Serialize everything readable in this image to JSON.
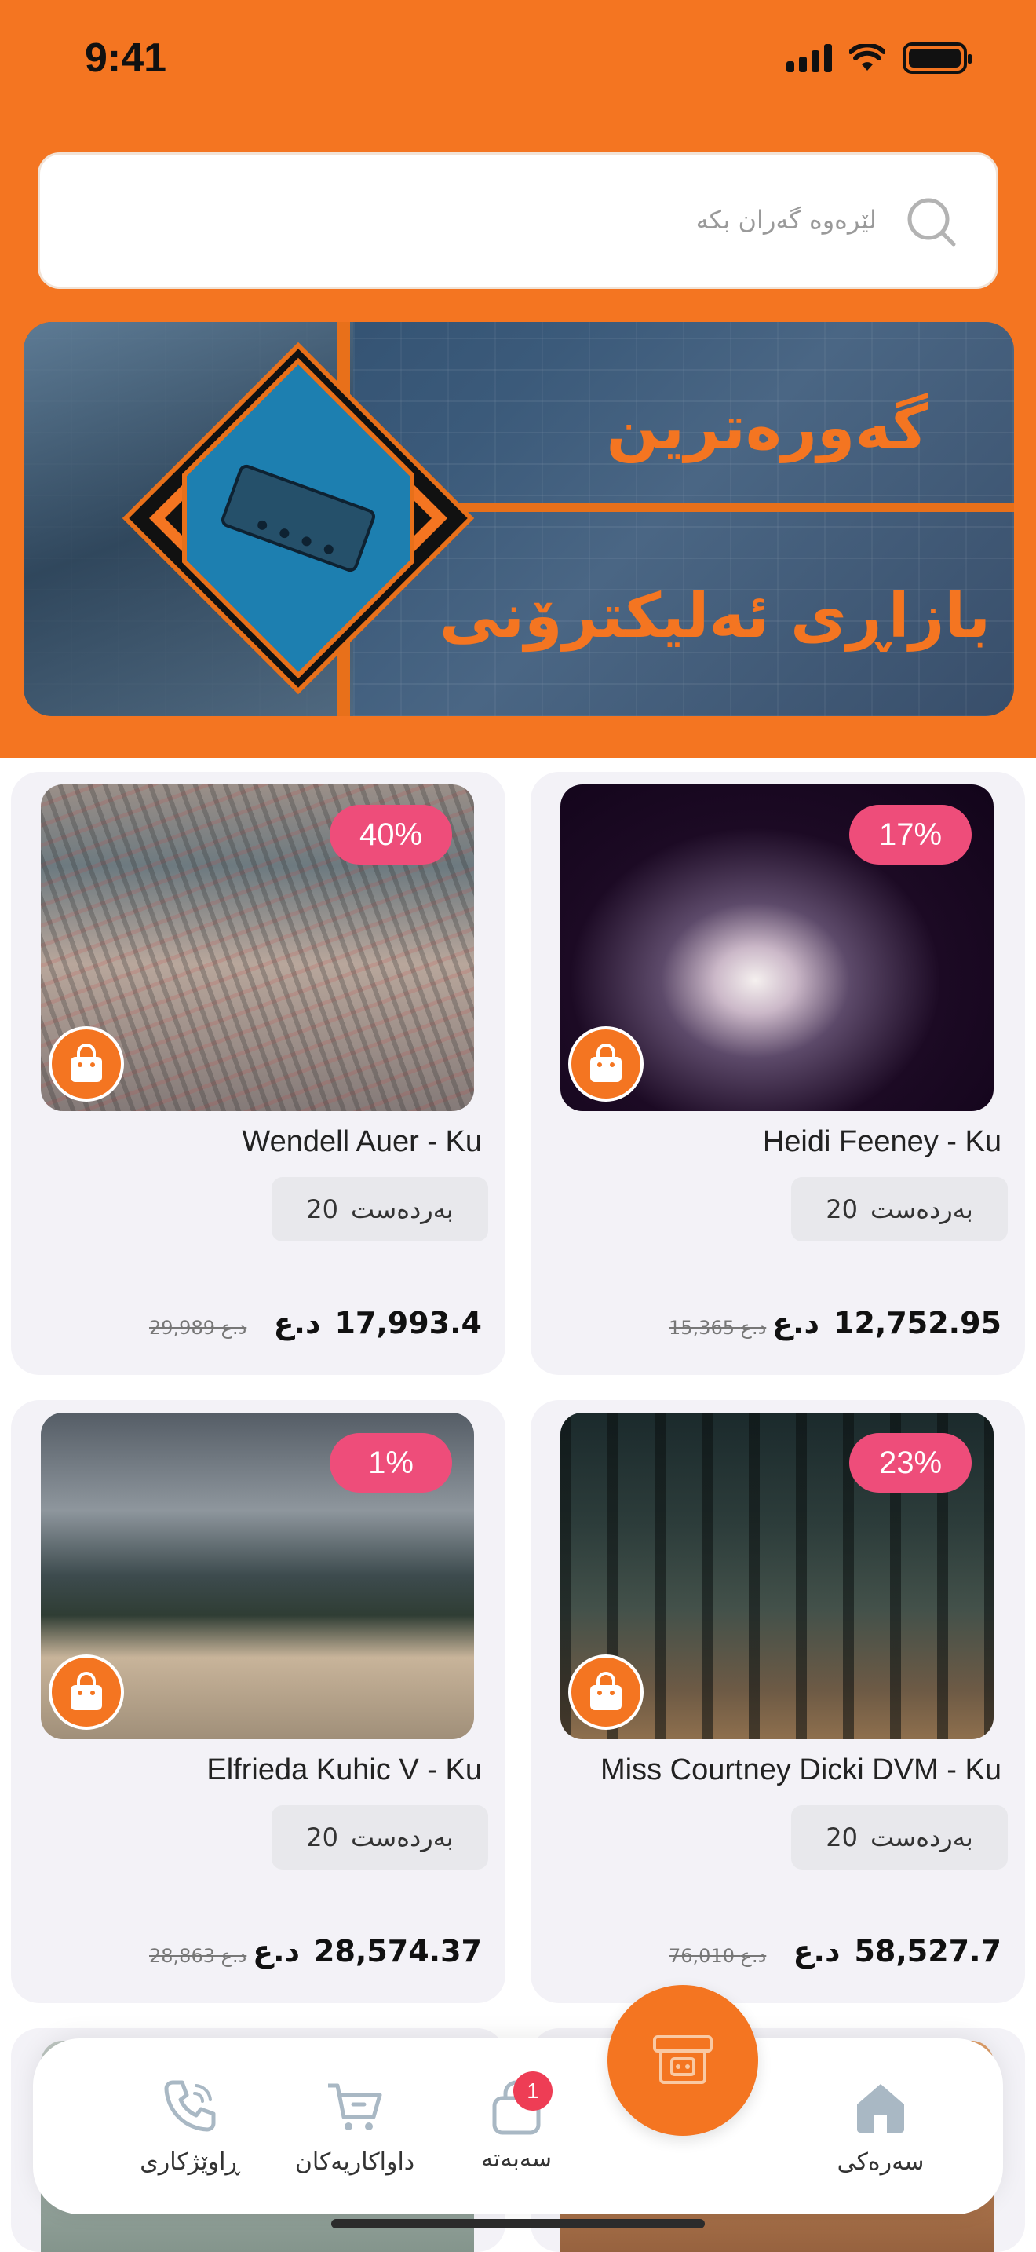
{
  "status_bar": {
    "time": "9:41"
  },
  "search": {
    "placeholder": "لێرەوە گەران بکە"
  },
  "banner": {
    "title_line1": "گەورەترین",
    "title_line2": "بازاڕی ئەلیکترۆنی"
  },
  "currency": "د.ع",
  "products": [
    {
      "name": "Heidi Feeney - Ku",
      "discount": "17%",
      "stock": "20",
      "stock_label": "بەردەست",
      "price": "12,752.95",
      "old_price": "15,365",
      "image": "smoke-silhouette"
    },
    {
      "name": "Wendell Auer - Ku",
      "discount": "40%",
      "stock": "20",
      "stock_label": "بەردەست",
      "price": "17,993.4",
      "old_price": "29,989",
      "image": "crowd-station"
    },
    {
      "name": "Miss Courtney Dicki DVM - Ku",
      "discount": "23%",
      "stock": "20",
      "stock_label": "بەردەست",
      "price": "58,527.7",
      "old_price": "76,010",
      "image": "forest-person"
    },
    {
      "name": "Elfrieda Kuhic V - Ku",
      "discount": "1%",
      "stock": "20",
      "stock_label": "بەردەست",
      "price": "28,574.37",
      "old_price": "28,863",
      "image": "beach-cliff"
    }
  ],
  "nav": {
    "home": "سەرەکی",
    "cart": "سەبەتە",
    "cart_badge": "1",
    "orders": "داواکاریەکان",
    "support": "ڕاوێژکاری"
  },
  "colors": {
    "brand": "#F47521",
    "discount": "#EE4D7A",
    "badge": "#EE3D55",
    "card": "#F3F2F7"
  },
  "icons": [
    "search-icon",
    "shopping-bag-icon",
    "home-icon",
    "cart-icon",
    "phone-icon",
    "store-icon"
  ]
}
